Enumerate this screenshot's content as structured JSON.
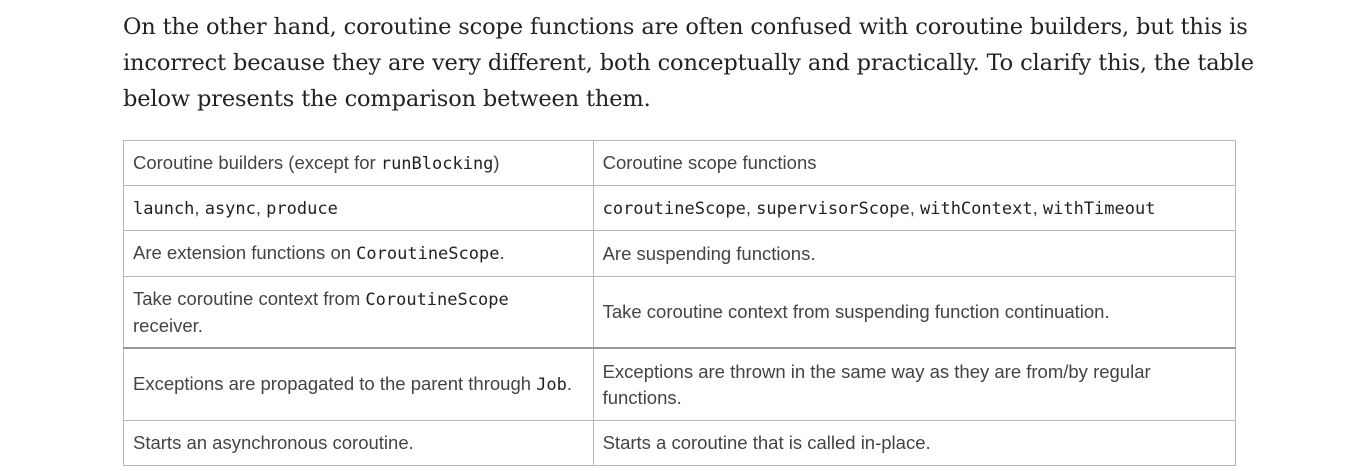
{
  "paragraph": {
    "text": "On the other hand, coroutine scope functions are often confused with coroutine builders, but this is incorrect because they are very different, both conceptually and practically. To clarify this, the table below presents the comparison between them."
  },
  "table": {
    "header_left": "Coroutine builders (except for ",
    "header_left_code": "runBlocking",
    "header_left_end": ")",
    "header_right": "Coroutine scope functions",
    "rows": [
      {
        "left": [
          {
            "code": "launch"
          },
          {
            "text": ", "
          },
          {
            "code": "async"
          },
          {
            "text": ", "
          },
          {
            "code": "produce"
          }
        ],
        "right": [
          {
            "code": "coroutineScope"
          },
          {
            "text": ", "
          },
          {
            "code": "supervisorScope"
          },
          {
            "text": ", "
          },
          {
            "code": "withContext"
          },
          {
            "text": ", "
          },
          {
            "code": "withTimeout"
          }
        ]
      },
      {
        "left": [
          {
            "text": "Are extension functions on "
          },
          {
            "code": "CoroutineScope"
          },
          {
            "text": "."
          }
        ],
        "right": [
          {
            "text": "Are suspending functions."
          }
        ]
      },
      {
        "left": [
          {
            "text": "Take coroutine context from "
          },
          {
            "code": "CoroutineScope"
          },
          {
            "text": " receiver."
          }
        ],
        "right": [
          {
            "text": "Take coroutine context from suspending function continuation."
          }
        ]
      },
      {
        "left": [
          {
            "text": "Exceptions are propagated to the parent through "
          },
          {
            "code": "Job"
          },
          {
            "text": "."
          }
        ],
        "right": [
          {
            "text": "Exceptions are thrown in the same way as they are from/by regular functions."
          }
        ]
      },
      {
        "left": [
          {
            "text": "Starts an asynchronous coroutine."
          }
        ],
        "right": [
          {
            "text": "Starts a coroutine that is called in-place."
          }
        ]
      }
    ]
  }
}
